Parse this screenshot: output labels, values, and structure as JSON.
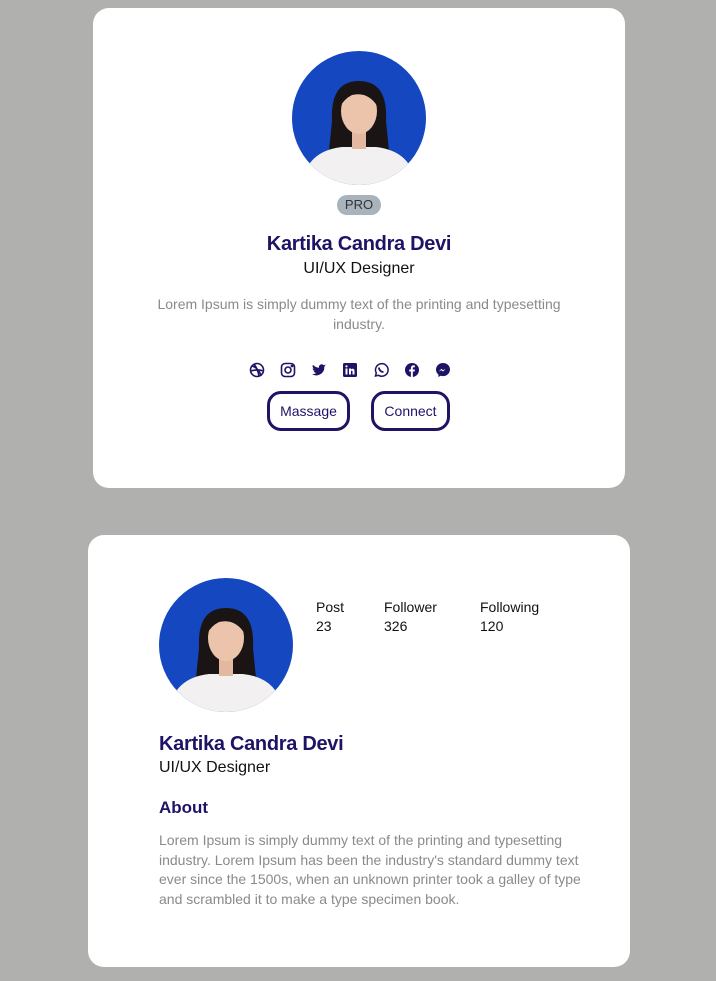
{
  "card1": {
    "badge": "PRO",
    "name": "Kartika Candra Devi",
    "role": "UI/UX Designer",
    "bio": "Lorem Ipsum is simply dummy text of the printing and typesetting industry.",
    "social_icons": [
      "dribbble-icon",
      "instagram-icon",
      "twitter-icon",
      "linkedin-icon",
      "whatsapp-icon",
      "facebook-icon",
      "messenger-icon"
    ],
    "buttons": {
      "message": "Massage",
      "connect": "Connect"
    }
  },
  "card2": {
    "stats": [
      {
        "label": "Post",
        "value": "23"
      },
      {
        "label": "Follower",
        "value": "326"
      },
      {
        "label": "Following",
        "value": "120"
      }
    ],
    "name": "Kartika Candra Devi",
    "role": "UI/UX Designer",
    "about_title": "About",
    "about_text": "Lorem Ipsum is simply dummy text of the printing and typesetting industry. Lorem Ipsum has been the industry's standard dummy text ever since the 1500s, when an unknown printer took a galley of type and scrambled it to make a type specimen book."
  },
  "colors": {
    "accent": "#1e1466",
    "background": "#b0b0ae",
    "photo_bg": "#1447c0",
    "badge": "#a9b3bb"
  }
}
